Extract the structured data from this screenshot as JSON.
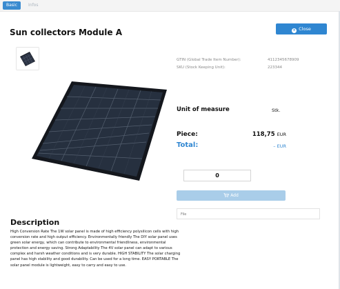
{
  "tabs": [
    {
      "label": "Basic"
    },
    {
      "label": "Infos"
    }
  ],
  "product": {
    "title": "Sun collectors Module A"
  },
  "close_button": {
    "label": "Close",
    "icon": "x-circle-icon"
  },
  "identifiers": [
    {
      "label": "GTIN (Global Trade Item Number):",
      "value": "4112345678909"
    },
    {
      "label": "SKU (Stock Keeping Unit):",
      "value": "223344"
    }
  ],
  "unit_of_measure": {
    "label": "Unit of measure",
    "value": "Stk."
  },
  "pricing": {
    "piece_label": "Piece:",
    "piece_value": "118,75",
    "currency": "EUR",
    "total_label": "Total:",
    "total_value": "– EUR"
  },
  "quantity": {
    "value": "0"
  },
  "add_button": {
    "label": "Add",
    "icon": "cart-icon"
  },
  "file_field": {
    "label": "File"
  },
  "description": {
    "title": "Description",
    "text": "High Conversion Rate The 1W solar panel is made of high efficiency polysilicon cells with high conversion rate and high output efficiency. Environmentally friendly The DIY solar panel uses green solar energy, which can contribute to environmental friendliness, environmental protection and energy saving. Strong Adaptability The 4V solar panel can adapt to various complex and harsh weather conditions and is very durable. HIGH STABILITY The solar charging panel has high stability and good durability. Can be used for a long time. EASY PORTABLE The solar panel module is lightweight, easy to carry and easy to use."
  },
  "colors": {
    "accent": "#2f86d1",
    "add_button_disabled": "#a9cde9",
    "tab_active": "#3a8bd0"
  }
}
